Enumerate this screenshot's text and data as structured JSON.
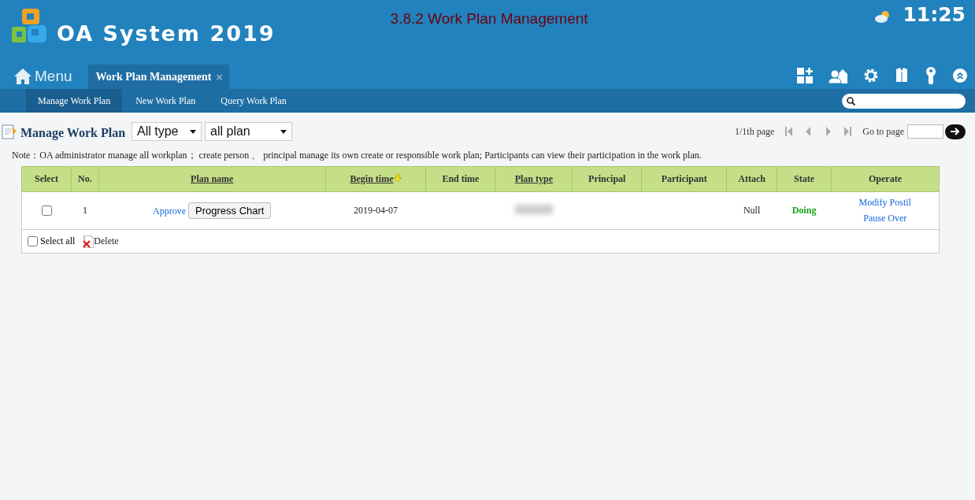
{
  "header": {
    "app_name": "OA System 2019",
    "page_title": "3.8.2 Work Plan Management",
    "time": "11:25"
  },
  "menu": {
    "label": "Menu"
  },
  "tabs": [
    {
      "label": "Work Plan Management",
      "close": "×",
      "selected": true
    }
  ],
  "subnav": [
    {
      "label": "Manage Work Plan",
      "selected": true
    },
    {
      "label": "New Work Plan",
      "selected": false
    },
    {
      "label": "Query Work Plan",
      "selected": false
    }
  ],
  "toolbar": {
    "title": "Manage Work Plan",
    "filters": [
      {
        "value": "All type"
      },
      {
        "value": "all plan"
      }
    ]
  },
  "pagination": {
    "page_info": "1/1th page",
    "goto_label": "Go to page"
  },
  "note": "Note：OA administrator manage all workplan； create person 、 principal manage its own create or responsible work plan; Participants can view their participation in the work plan.",
  "table": {
    "columns": [
      {
        "label": "Select",
        "sortable": false,
        "sorted": false
      },
      {
        "label": "No.",
        "sortable": false,
        "sorted": false
      },
      {
        "label": "Plan name",
        "sortable": true,
        "sorted": false
      },
      {
        "label": "Begin time",
        "sortable": true,
        "sorted": true
      },
      {
        "label": "End time",
        "sortable": false,
        "sorted": false
      },
      {
        "label": "Plan type",
        "sortable": true,
        "sorted": false
      },
      {
        "label": "Principal",
        "sortable": false,
        "sorted": false
      },
      {
        "label": "Participant",
        "sortable": false,
        "sorted": false
      },
      {
        "label": "Attach",
        "sortable": false,
        "sorted": false
      },
      {
        "label": "State",
        "sortable": false,
        "sorted": false
      },
      {
        "label": "Operate",
        "sortable": false,
        "sorted": false
      }
    ],
    "rows": [
      {
        "checked": false,
        "no": "1",
        "approve": "Approve",
        "chart_button": "Progress Chart",
        "begin_time": "2019-04-07",
        "attach": "Null",
        "state": "Doing",
        "operations": [
          "Modify Postil",
          "Pause Over"
        ]
      }
    ],
    "footer": {
      "select_all": "Select all",
      "select_all_checked": false,
      "delete": "Delete"
    }
  }
}
